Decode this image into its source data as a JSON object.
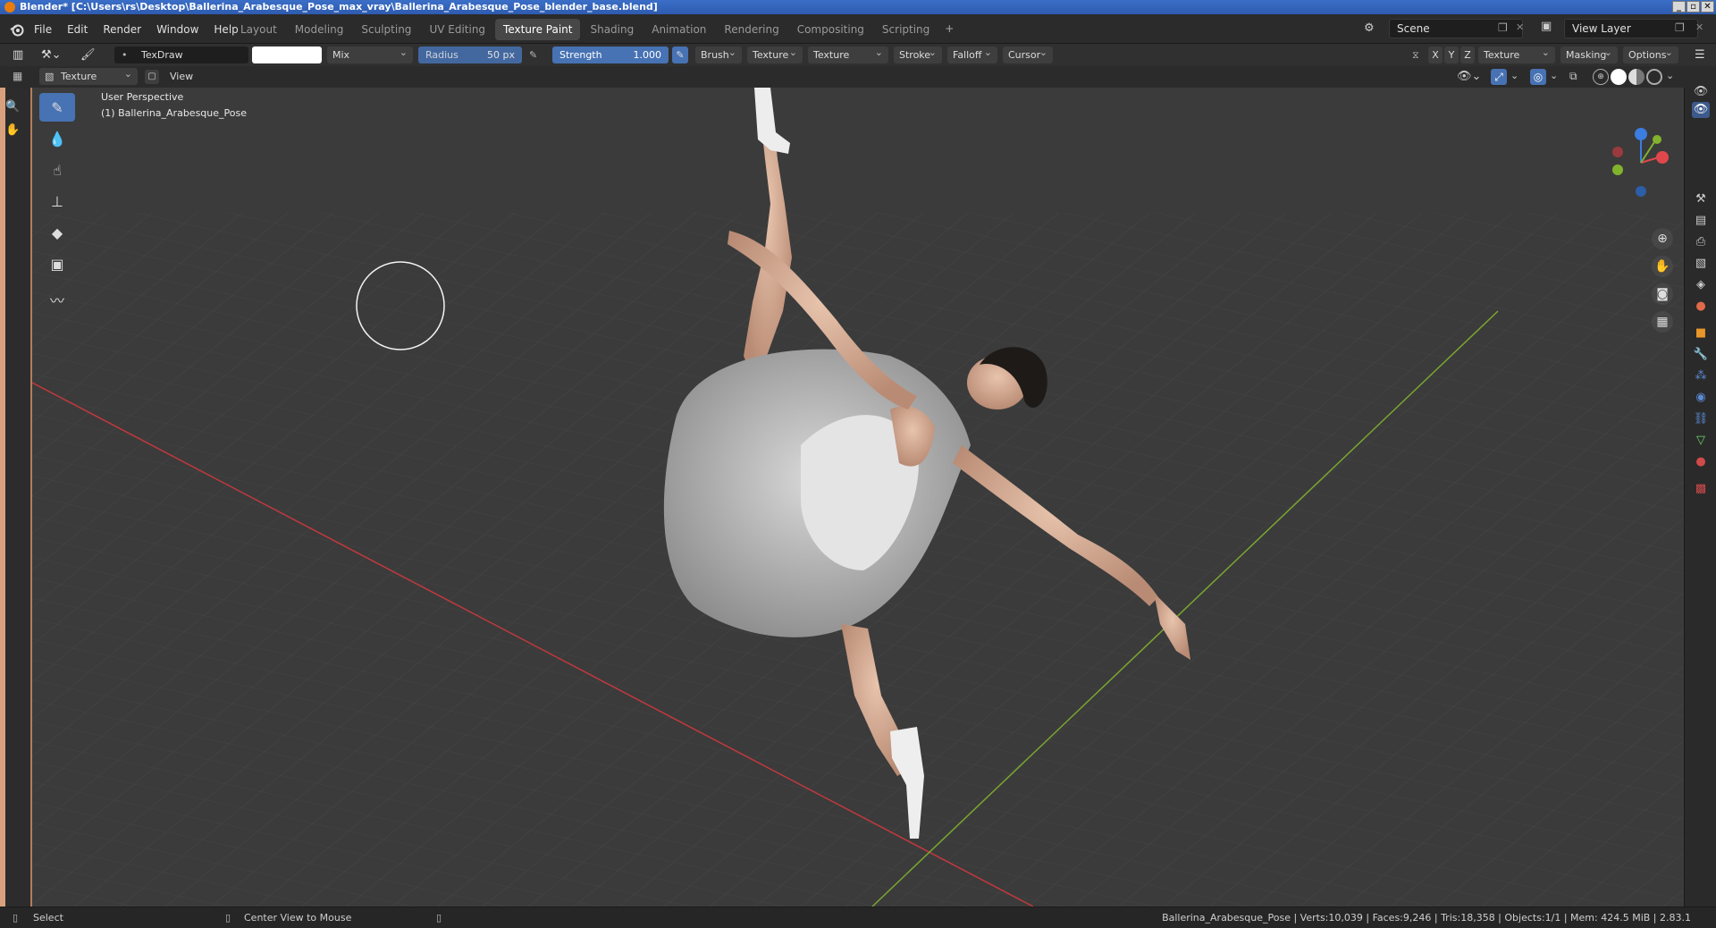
{
  "window": {
    "title": "Blender* [C:\\Users\\rs\\Desktop\\Ballerina_Arabesque_Pose_max_vray\\Ballerina_Arabesque_Pose_blender_base.blend]"
  },
  "menu": {
    "file": "File",
    "edit": "Edit",
    "render": "Render",
    "window": "Window",
    "help": "Help"
  },
  "workspaces": [
    "Layout",
    "Modeling",
    "Sculpting",
    "UV Editing",
    "Texture Paint",
    "Shading",
    "Animation",
    "Rendering",
    "Compositing",
    "Scripting"
  ],
  "active_workspace": "Texture Paint",
  "scene": {
    "name": "Scene",
    "view_layer": "View Layer"
  },
  "tool_header": {
    "brush_name": "TexDraw",
    "blend_mode": "Mix",
    "radius_label": "Radius",
    "radius_value": "50 px",
    "strength_label": "Strength",
    "strength_value": "1.000",
    "menus": [
      "Brush",
      "Texture",
      "Texture Mask",
      "Stroke",
      "Falloff",
      "Cursor"
    ],
    "axes": [
      "X",
      "Y",
      "Z"
    ],
    "texture_slots": "Texture Slots",
    "masking": "Masking",
    "options": "Options"
  },
  "view_header": {
    "mode": "Texture Paint",
    "view_menu": "View"
  },
  "viewport": {
    "perspective": "User Perspective",
    "object_label": "(1) Ballerina_Arabesque_Pose"
  },
  "status": {
    "select": "Select",
    "center_view": "Center View to Mouse",
    "stats": "Ballerina_Arabesque_Pose | Verts:10,039 | Faces:9,246 | Tris:18,358 | Objects:1/1 | Mem: 424.5 MiB | 2.83.1"
  },
  "colors": {
    "accent": "#4772b3",
    "x_axis": "#e0474c",
    "y_axis": "#82b32c",
    "z_axis": "#3b7de0",
    "side_strip": "#d9a07d"
  }
}
